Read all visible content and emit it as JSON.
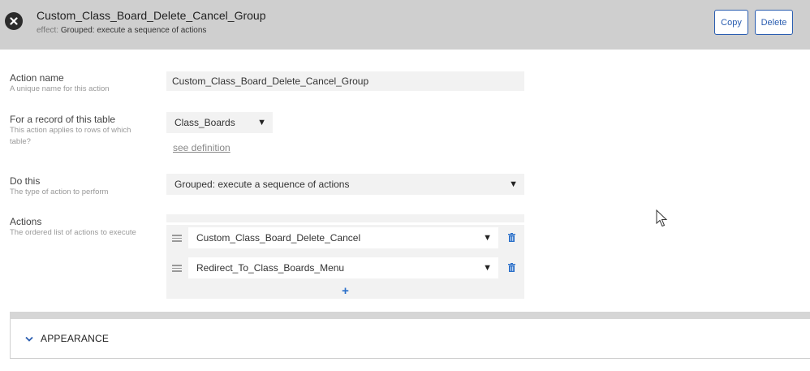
{
  "header": {
    "title": "Custom_Class_Board_Delete_Cancel_Group",
    "effect_prefix": "effect:",
    "effect_value": "Grouped: execute a sequence of actions",
    "copy_label": "Copy",
    "delete_label": "Delete"
  },
  "form": {
    "action_name": {
      "label": "Action name",
      "description": "A unique name for this action",
      "value": "Custom_Class_Board_Delete_Cancel_Group"
    },
    "table": {
      "label": "For a record of this table",
      "description": "This action applies to rows of which table?",
      "value": "Class_Boards",
      "link": "see definition"
    },
    "do_this": {
      "label": "Do this",
      "description": "The type of action to perform",
      "value": "Grouped: execute a sequence of actions"
    },
    "actions": {
      "label": "Actions",
      "description": "The ordered list of actions to execute",
      "items": [
        {
          "value": "Custom_Class_Board_Delete_Cancel"
        },
        {
          "value": "Redirect_To_Class_Boards_Menu"
        }
      ],
      "add_label": "+"
    }
  },
  "appearance": {
    "label": "APPEARANCE"
  },
  "icons": {
    "close": "close-circle-icon",
    "caret": "caret-down-icon",
    "drag": "drag-handle-icon",
    "trash": "trash-icon",
    "chevron": "chevron-down-icon",
    "cursor": "mouse-pointer-icon"
  },
  "colors": {
    "header_bg": "#cfcfcf",
    "accent": "#2a5db0",
    "field_bg": "#f2f2f2"
  }
}
